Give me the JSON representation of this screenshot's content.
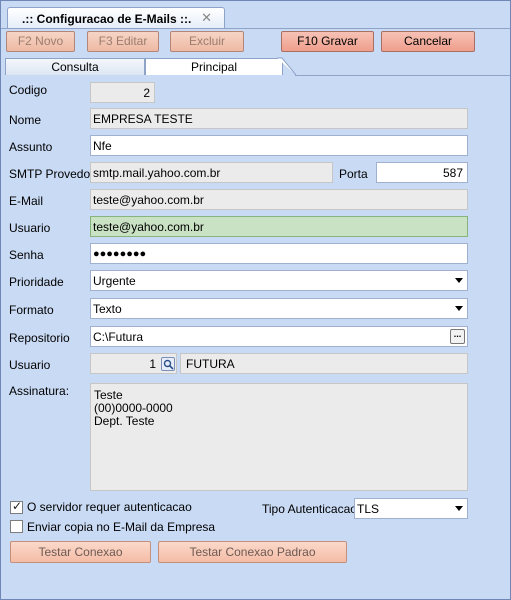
{
  "window": {
    "title": ".:: Configuracao de E-Mails ::.",
    "close_glyph": "✕"
  },
  "toolbar": {
    "novo_label": "F2 Novo",
    "editar_label": "F3 Editar",
    "excluir_label": "Excluir",
    "gravar_label": "F10 Gravar",
    "cancelar_label": "Cancelar"
  },
  "tabs": [
    {
      "label": "Consulta",
      "active": false
    },
    {
      "label": "Principal",
      "active": true
    }
  ],
  "form": {
    "codigo": {
      "label": "Codigo",
      "value": "2"
    },
    "nome": {
      "label": "Nome",
      "value": "EMPRESA TESTE"
    },
    "assunto": {
      "label": "Assunto",
      "value": "Nfe"
    },
    "smtp": {
      "label": "SMTP Provedor",
      "value": "smtp.mail.yahoo.com.br"
    },
    "porta": {
      "label": "Porta",
      "value": "587"
    },
    "email": {
      "label": "E-Mail",
      "value": "teste@yahoo.com.br"
    },
    "usuario": {
      "label": "Usuario",
      "value": "teste@yahoo.com.br"
    },
    "senha": {
      "label": "Senha",
      "value": "●●●●●●●●"
    },
    "prioridade": {
      "label": "Prioridade",
      "value": "Urgente"
    },
    "formato": {
      "label": "Formato",
      "value": "Texto"
    },
    "repositorio": {
      "label": "Repositorio",
      "value": "C:\\Futura",
      "button": "..."
    },
    "usuario_sistema": {
      "label": "Usuario",
      "code": "1",
      "name": "FUTURA"
    },
    "assinatura": {
      "label": "Assinatura:",
      "lines": [
        "Teste",
        "(00)0000-0000",
        "Dept. Teste"
      ]
    },
    "autenticacao": {
      "label": "O servidor requer autenticacao",
      "checked": true
    },
    "copia": {
      "label": "Enviar copia no E-Mail da Empresa",
      "checked": false
    },
    "tipo_autenticacao": {
      "label": "Tipo Autenticacao",
      "value": "TLS"
    }
  },
  "actions": {
    "testar_label": "Testar Conexao",
    "testar_padrao_label": "Testar Conexao Padrao"
  }
}
